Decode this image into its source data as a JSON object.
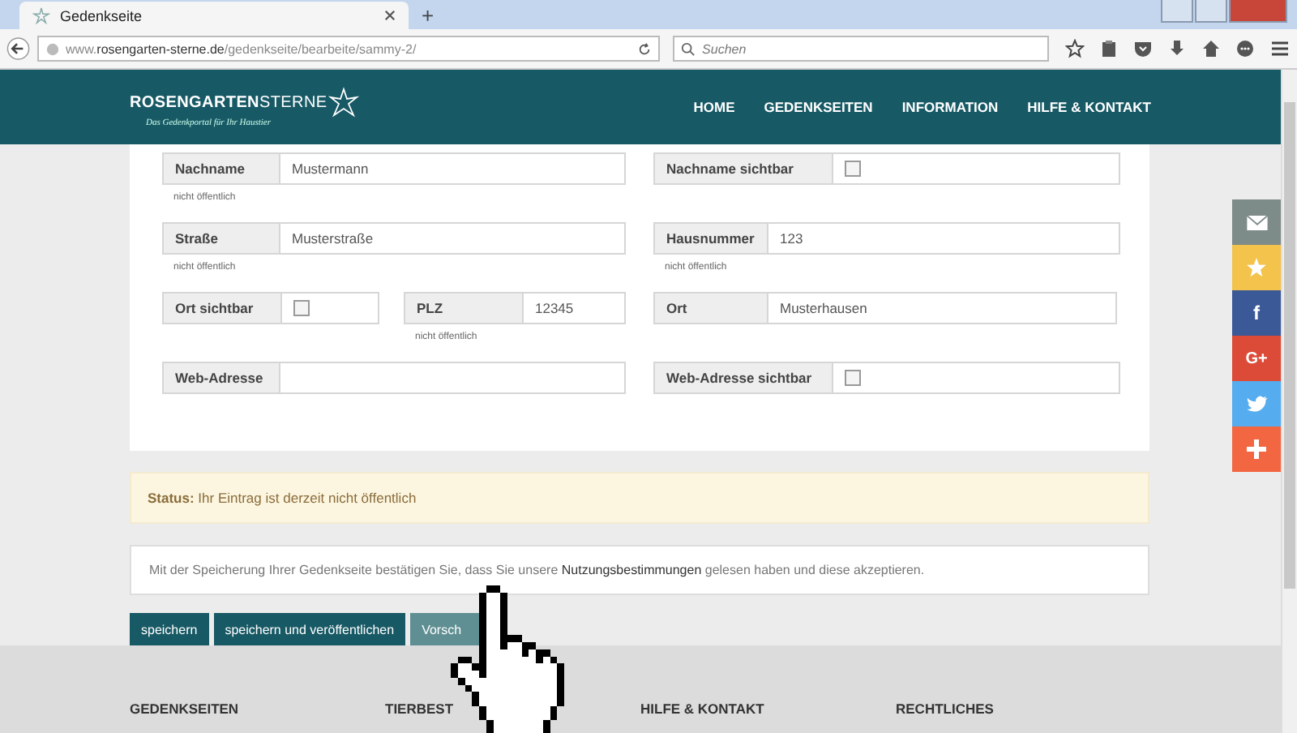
{
  "browser": {
    "tab_title": "Gedenkseite",
    "new_tab": "+",
    "url": "www.**rosengarten-sterne.de**/gedenkseite/bearbeite/sammy-2/",
    "search": {
      "placeholder": "Suchen"
    }
  },
  "header": {
    "logo_bold": "ROSENGARTEN",
    "logo_light": "STERNE",
    "tagline": "Das Gedenkportal für Ihr Haustier",
    "nav": [
      "HOME",
      "GEDENKSEITEN",
      "INFORMATION",
      "HILFE & KONTAKT"
    ]
  },
  "form": {
    "rows": [
      [
        {
          "kind": "text",
          "label": "Nachname",
          "value": "Mustermann",
          "hint": "nicht öffentlich"
        },
        {
          "kind": "checkbox",
          "label": "Nachname sichtbar",
          "checked": false
        }
      ],
      [
        {
          "kind": "text",
          "label": "Straße",
          "value": "Musterstraße",
          "hint": "nicht öffentlich"
        },
        {
          "kind": "text",
          "label": "Hausnummer",
          "value": "123",
          "hint": "nicht öffentlich"
        }
      ],
      [
        {
          "kind": "checkbox",
          "label": "Ort sichtbar",
          "checked": false
        },
        {
          "kind": "text",
          "label": "PLZ",
          "value": "12345",
          "hint": "nicht öffentlich"
        },
        {
          "kind": "text",
          "label": "Ort",
          "value": "Musterhausen"
        }
      ],
      [
        {
          "kind": "text",
          "label": "Web-Adresse"
        },
        {
          "kind": "checkbox",
          "label": "Web-Adresse sichtbar",
          "checked": false
        }
      ]
    ]
  },
  "status": {
    "label": "Status:",
    "text": "Ihr Eintrag ist derzeit nicht öffentlich"
  },
  "notice": {
    "before": "Mit der Speicherung Ihrer Gedenkseite bestätigen Sie, dass Sie unsere",
    "link": "Nutzungsbestimmungen",
    "after": "gelesen haben und diese akzeptieren."
  },
  "buttons": [
    {
      "label": "speichern",
      "kind": "primary"
    },
    {
      "label": "speichern und veröffentlichen",
      "kind": "primary"
    },
    {
      "label": "Vorsch",
      "kind": "secondary"
    }
  ],
  "footer": [
    "GEDENKSEITEN",
    "TIERBEST",
    "HILFE & KONTAKT",
    "RECHTLICHES"
  ],
  "social": [
    {
      "kind": "mail",
      "color": "#7d8b89"
    },
    {
      "kind": "star",
      "color": "#f3c34b"
    },
    {
      "kind": "facebook",
      "label": "f",
      "color": "#3b5897"
    },
    {
      "kind": "google",
      "label": "G+",
      "color": "#dc4a38"
    },
    {
      "kind": "twitter",
      "color": "#55acee"
    },
    {
      "kind": "share",
      "color": "#f26641"
    }
  ]
}
